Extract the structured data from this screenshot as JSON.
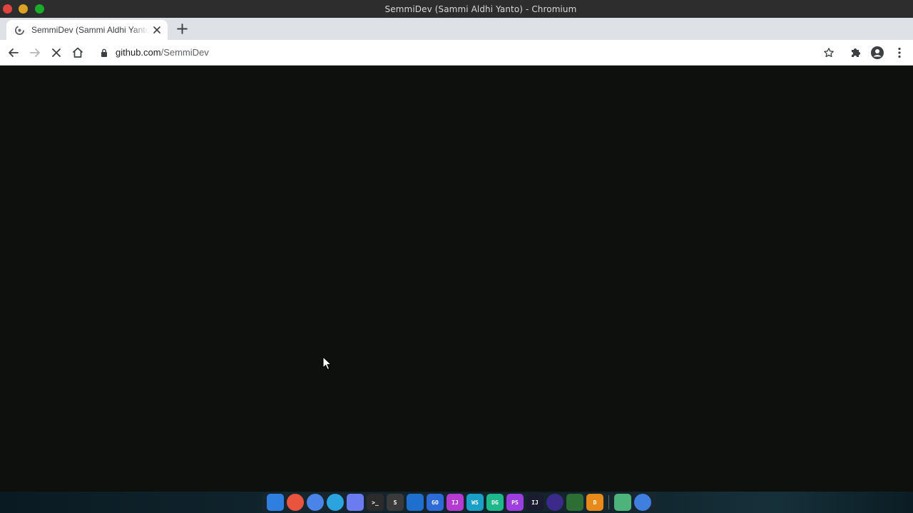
{
  "window": {
    "title": "SemmiDev (Sammi Aldhi Yanto) - Chromium"
  },
  "tabs": [
    {
      "title": "SemmiDev (Sammi Aldhi Yanto) - Chromium",
      "display": "SemmiDev (Sammi Aldhi Yanto)",
      "active": true
    }
  ],
  "toolbar": {
    "url_host": "github.com",
    "url_path": "/SemmiDev",
    "state": "loading"
  },
  "dock": {
    "apps": [
      {
        "name": "finder",
        "label": ""
      },
      {
        "name": "firefox",
        "label": ""
      },
      {
        "name": "chromium",
        "label": ""
      },
      {
        "name": "telegram",
        "label": ""
      },
      {
        "name": "discord",
        "label": ""
      },
      {
        "name": "terminal",
        "label": ">_"
      },
      {
        "name": "sublime-text",
        "label": "S"
      },
      {
        "name": "vscode",
        "label": ""
      },
      {
        "name": "goland",
        "label": "GO"
      },
      {
        "name": "intellij",
        "label": "IJ"
      },
      {
        "name": "webstorm",
        "label": "WS"
      },
      {
        "name": "datagrip",
        "label": "DG"
      },
      {
        "name": "phpstorm",
        "label": "PS"
      },
      {
        "name": "intellij-community",
        "label": "IJ"
      },
      {
        "name": "eclipse",
        "label": ""
      },
      {
        "name": "mongodb-compass",
        "label": ""
      },
      {
        "name": "draw-app",
        "label": "D"
      },
      {
        "name": "files",
        "label": ""
      },
      {
        "name": "chrome-alt",
        "label": ""
      }
    ],
    "colors": {
      "finder": "#2f7fe0",
      "firefox": "#e8543d",
      "chromium": "#4a84e8",
      "telegram": "#2aa3de",
      "discord": "#6b7cf0",
      "terminal": "#2b2b2b",
      "sublime-text": "#3a3a3a",
      "vscode": "#1f6fcf",
      "goland": "#2d6bd9",
      "intellij": "#b63bd1",
      "webstorm": "#1aa0c8",
      "datagrip": "#1fb88a",
      "phpstorm": "#9e3ee0",
      "intellij-community": "#1b1b2f",
      "eclipse": "#3b2a8a",
      "mongodb-compass": "#2d6e35",
      "draw-app": "#e88a1a",
      "files": "#4cb37a",
      "chrome-alt": "#3f7fe0"
    }
  }
}
